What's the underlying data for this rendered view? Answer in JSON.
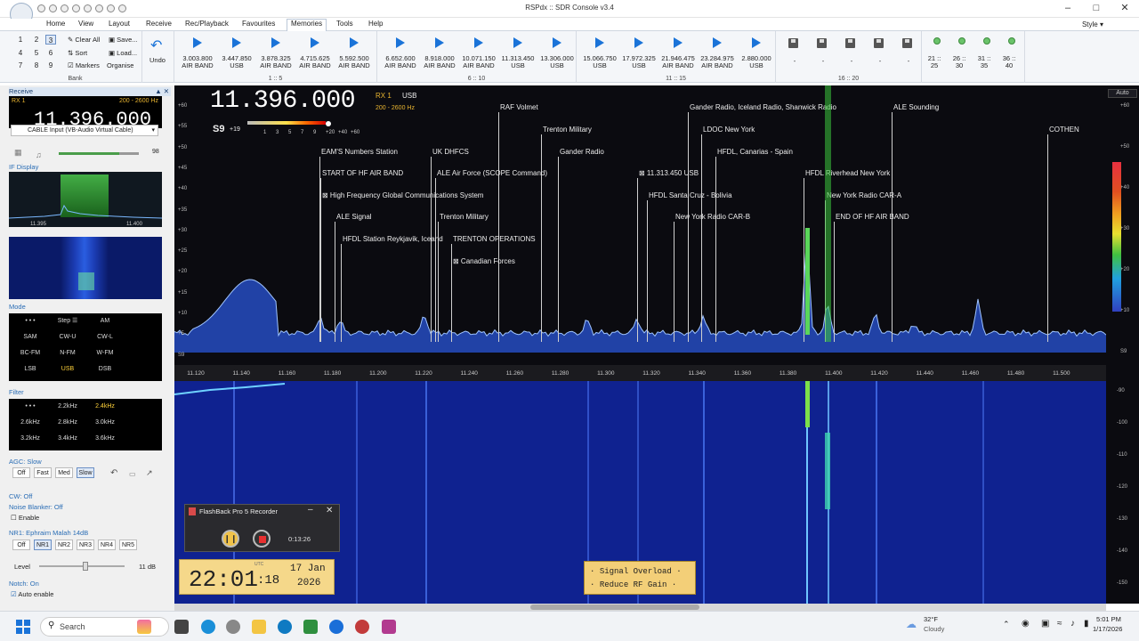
{
  "window": {
    "title": "RSPdx :: SDR Console v3.4",
    "style_label": "Style"
  },
  "menu": [
    "Home",
    "View",
    "Layout",
    "Receive",
    "Rec/Playback",
    "Favourites",
    "Memories",
    "Tools",
    "Help"
  ],
  "bank": {
    "numbers": [
      "1",
      "2",
      "3",
      "4",
      "5",
      "6",
      "7",
      "8",
      "9"
    ],
    "selected": "3",
    "clear_all": "Clear All",
    "save": "Save...",
    "sort": "Sort",
    "load": "Load...",
    "markers": "Markers",
    "organise": "Organise",
    "label": "Bank",
    "undo": "Undo"
  },
  "memory_groups": [
    {
      "label": "1 :: 5",
      "items": [
        {
          "freq": "3.003.800",
          "mode": "AIR BAND"
        },
        {
          "freq": "3.447.850",
          "mode": "USB"
        },
        {
          "freq": "3.878.325",
          "mode": "AIR BAND"
        },
        {
          "freq": "4.715.625",
          "mode": "AIR BAND"
        },
        {
          "freq": "5.592.500",
          "mode": "AIR BAND"
        }
      ]
    },
    {
      "label": "6 :: 10",
      "items": [
        {
          "freq": "6.652.600",
          "mode": "AIR BAND"
        },
        {
          "freq": "8.918.000",
          "mode": "AIR BAND"
        },
        {
          "freq": "10.071.150",
          "mode": "AIR BAND"
        },
        {
          "freq": "11.313.450",
          "mode": "USB"
        },
        {
          "freq": "13.306.000",
          "mode": "USB"
        }
      ]
    },
    {
      "label": "11 :: 15",
      "items": [
        {
          "freq": "15.066.750",
          "mode": "USB"
        },
        {
          "freq": "17.972.325",
          "mode": "USB"
        },
        {
          "freq": "21.946.475",
          "mode": "AIR BAND"
        },
        {
          "freq": "23.284.975",
          "mode": "AIR BAND"
        },
        {
          "freq": "2.880.000",
          "mode": "USB"
        }
      ]
    },
    {
      "label": "16 :: 20",
      "items": [
        "-",
        "-",
        "-",
        "-",
        "-"
      ]
    }
  ],
  "memory_extra": [
    {
      "a": "21 ::",
      "b": "25"
    },
    {
      "a": "26 ::",
      "b": "30"
    },
    {
      "a": "31 ::",
      "b": "35"
    },
    {
      "a": "36 ::",
      "b": "40"
    }
  ],
  "receive": {
    "header": "Receive",
    "rx": "RX 1",
    "bw": "200 - 2600 Hz",
    "freq_partial": "11.396.000",
    "input": "CABLE Input (VB-Audio Virtual Cable)",
    "volume": "98"
  },
  "if_display": {
    "header": "IF Display",
    "tick1": "11.395",
    "tick2": "11.400"
  },
  "mode": {
    "header": "Mode",
    "buttons": [
      "• • •",
      "Step ☰",
      "AM",
      "SAM",
      "CW-U",
      "CW-L",
      "BC-FM",
      "N-FM",
      "W-FM",
      "LSB",
      "USB",
      "DSB"
    ],
    "selected": "USB"
  },
  "filter": {
    "header": "Filter",
    "buttons": [
      "• • •",
      "2.2kHz",
      "2.4kHz",
      "2.6kHz",
      "2.8kHz",
      "3.0kHz",
      "3.2kHz",
      "3.4kHz",
      "3.6kHz"
    ],
    "selected": "2.4kHz"
  },
  "agc": {
    "header": "AGC: Slow",
    "buttons": [
      "Off",
      "Fast",
      "Med",
      "Slow"
    ],
    "selected": "Slow"
  },
  "cw": {
    "header": "CW: Off"
  },
  "nb": {
    "header": "Noise Blanker: Off",
    "enable": "Enable"
  },
  "nr": {
    "header": "NR1: Ephraim Malah 14dB",
    "buttons": [
      "Off",
      "NR1",
      "NR2",
      "NR3",
      "NR4",
      "NR5"
    ],
    "selected": "NR1",
    "level_label": "Level",
    "level_value": "11 dB"
  },
  "notch": {
    "header": "Notch: On",
    "auto": "Auto enable"
  },
  "display": {
    "freq": "11.396.000",
    "rx": "RX 1",
    "mode": "USB",
    "bw": "200 - 2600 Hz",
    "smeter": "S9",
    "smeter_plus": "+19",
    "scale": [
      "1",
      "3",
      "5",
      "7",
      "9",
      "+20",
      "+40",
      "+60"
    ],
    "auto": "Auto"
  },
  "spectrum_y": [
    "+60",
    "+55",
    "+50",
    "+45",
    "+40",
    "+35",
    "+30",
    "+25",
    "+20",
    "+15",
    "+10",
    "+5",
    "S9"
  ],
  "right_y": [
    "+60",
    "+50",
    "+40",
    "+30",
    "+20",
    "+10",
    "S9"
  ],
  "freq_ticks": [
    "11.120",
    "11.140",
    "11.160",
    "11.180",
    "11.200",
    "11.220",
    "11.240",
    "11.260",
    "11.280",
    "11.300",
    "11.320",
    "11.340",
    "11.360",
    "11.380",
    "11.400",
    "11.420",
    "11.440",
    "11.460",
    "11.480",
    "11.500"
  ],
  "wf_right": [
    "-90",
    "-100",
    "-110",
    "-120",
    "-130",
    "-140",
    "-150"
  ],
  "markers": [
    {
      "text": "RAF Volmet"
    },
    {
      "text": "Trenton Military"
    },
    {
      "text": "Gander Radio"
    },
    {
      "text": "Gander Radio, Iceland Radio, Shanwick Radio"
    },
    {
      "text": "LDOC New York"
    },
    {
      "text": "HFDL, Canarias - Spain"
    },
    {
      "text": "ALE Sounding"
    },
    {
      "text": "COTHEN"
    },
    {
      "text": "EAM'S Numbers Station"
    },
    {
      "text": "UK DHFCS"
    },
    {
      "text": "START OF HF AIR BAND"
    },
    {
      "text": "ALE  Air Force (SCOPE Command)"
    },
    {
      "text": "⊠ 11.313.450 USB"
    },
    {
      "text": "HFDL Riverhead New York"
    },
    {
      "text": "⊠ High Frequency Global Communications System"
    },
    {
      "text": "HFDL Santa Cruz - Bolivia"
    },
    {
      "text": "New York Radio CAR-A"
    },
    {
      "text": "ALE Signal"
    },
    {
      "text": "Trenton Military"
    },
    {
      "text": "New York Radio CAR-B"
    },
    {
      "text": "END OF HF AIR BAND"
    },
    {
      "text": "HFDL Station Reykjavik, Iceand"
    },
    {
      "text": "TRENTON OPERATIONS"
    },
    {
      "text": "⊠ Canadian Forces"
    }
  ],
  "recorder": {
    "title": "FlashBack Pro 5 Recorder",
    "time": "0:13:26"
  },
  "clock": {
    "hm": "22:01",
    "sec": ":18",
    "tz": "UTC",
    "date": "17 Jan",
    "year": "2026"
  },
  "overload": {
    "line1": "Signal Overload",
    "line2": "Reduce RF Gain"
  },
  "taskbar": {
    "search": "Search",
    "temp": "32°F",
    "weather": "Cloudy",
    "time": "5:01 PM",
    "date": "1/17/2026"
  }
}
